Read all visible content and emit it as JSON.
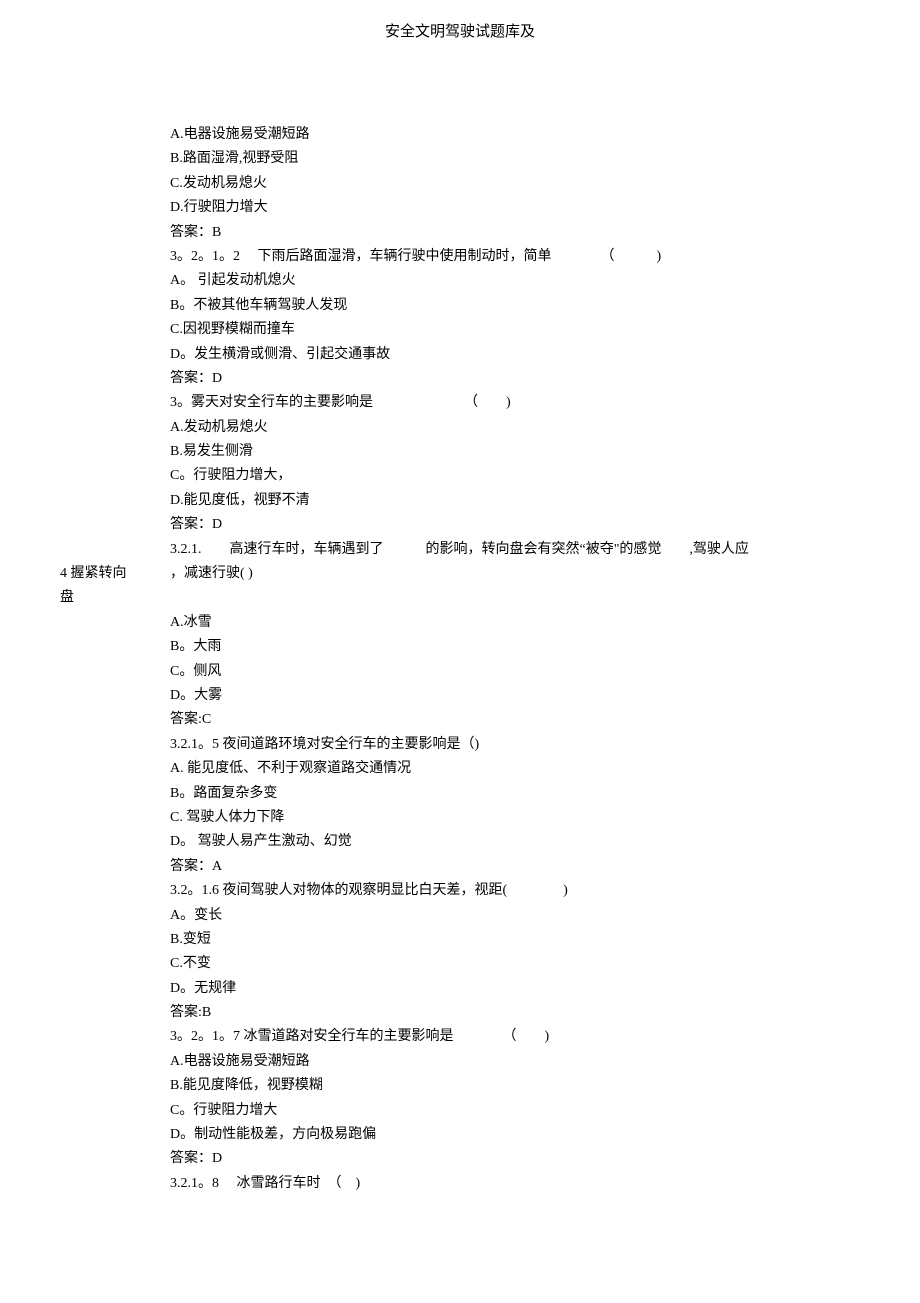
{
  "title": "安全文明驾驶试题库及",
  "lines": [
    {
      "text": "A.电器设施易受潮短路"
    },
    {
      "text": "B.路面湿滑,视野受阻"
    },
    {
      "text": "C.发动机易熄火"
    },
    {
      "text": "D.行驶阻力增大"
    },
    {
      "text": "答案：B"
    },
    {
      "text": "3。2。1。2　 下雨后路面湿滑，车辆行驶中使用制动时，简单　　　　（　　　)"
    },
    {
      "text": "A。 引起发动机熄火"
    },
    {
      "text": "B。不被其他车辆驾驶人发现"
    },
    {
      "text": "C.因视野模糊而撞车"
    },
    {
      "text": "D。发生横滑或侧滑、引起交通事故"
    },
    {
      "text": "答案：D"
    },
    {
      "text": "3。雾天对安全行车的主要影响是　　　　　　　（　　)"
    },
    {
      "text": "A.发动机易熄火"
    },
    {
      "text": "B.易发生侧滑"
    },
    {
      "text": "C。行驶阻力增大，"
    },
    {
      "text": "D.能见度低，视野不清"
    },
    {
      "text": "答案：D"
    },
    {
      "text": "3.2.1.　　高速行车时，车辆遇到了　　　的影响，转向盘会有突然“被夺\"的感觉　　,驾驶人应",
      "hanging": null
    },
    {
      "text": "，减速行驶( )",
      "hanging": "4 握紧转向"
    },
    {
      "text": "",
      "hanging": "盘"
    },
    {
      "text": "A.冰雪"
    },
    {
      "text": "B。大雨"
    },
    {
      "text": "C。侧风"
    },
    {
      "text": "D。大雾"
    },
    {
      "text": "答案:C"
    },
    {
      "text": "3.2.1。5 夜间道路环境对安全行车的主要影响是（)"
    },
    {
      "text": "A. 能见度低、不利于观察道路交通情况"
    },
    {
      "text": "B。路面复杂多变"
    },
    {
      "text": "C. 驾驶人体力下降"
    },
    {
      "text": "D。 驾驶人易产生激动、幻觉"
    },
    {
      "text": "答案：A"
    },
    {
      "text": "3.2。1.6 夜间驾驶人对物体的观察明显比白天差，视距(　　　　)"
    },
    {
      "text": "A。变长"
    },
    {
      "text": "B.变短"
    },
    {
      "text": "C.不变"
    },
    {
      "text": "D。无规律"
    },
    {
      "text": "答案:B"
    },
    {
      "text": "3。2。1。7 冰雪道路对安全行车的主要影响是　　　　（　　)"
    },
    {
      "text": "A.电器设施易受潮短路"
    },
    {
      "text": "B.能见度降低，视野模糊"
    },
    {
      "text": "C。行驶阻力增大"
    },
    {
      "text": "D。制动性能极差，方向极易跑偏"
    },
    {
      "text": "答案：D"
    },
    {
      "text": "3.2.1。8　 冰雪路行车时　（　)"
    }
  ]
}
